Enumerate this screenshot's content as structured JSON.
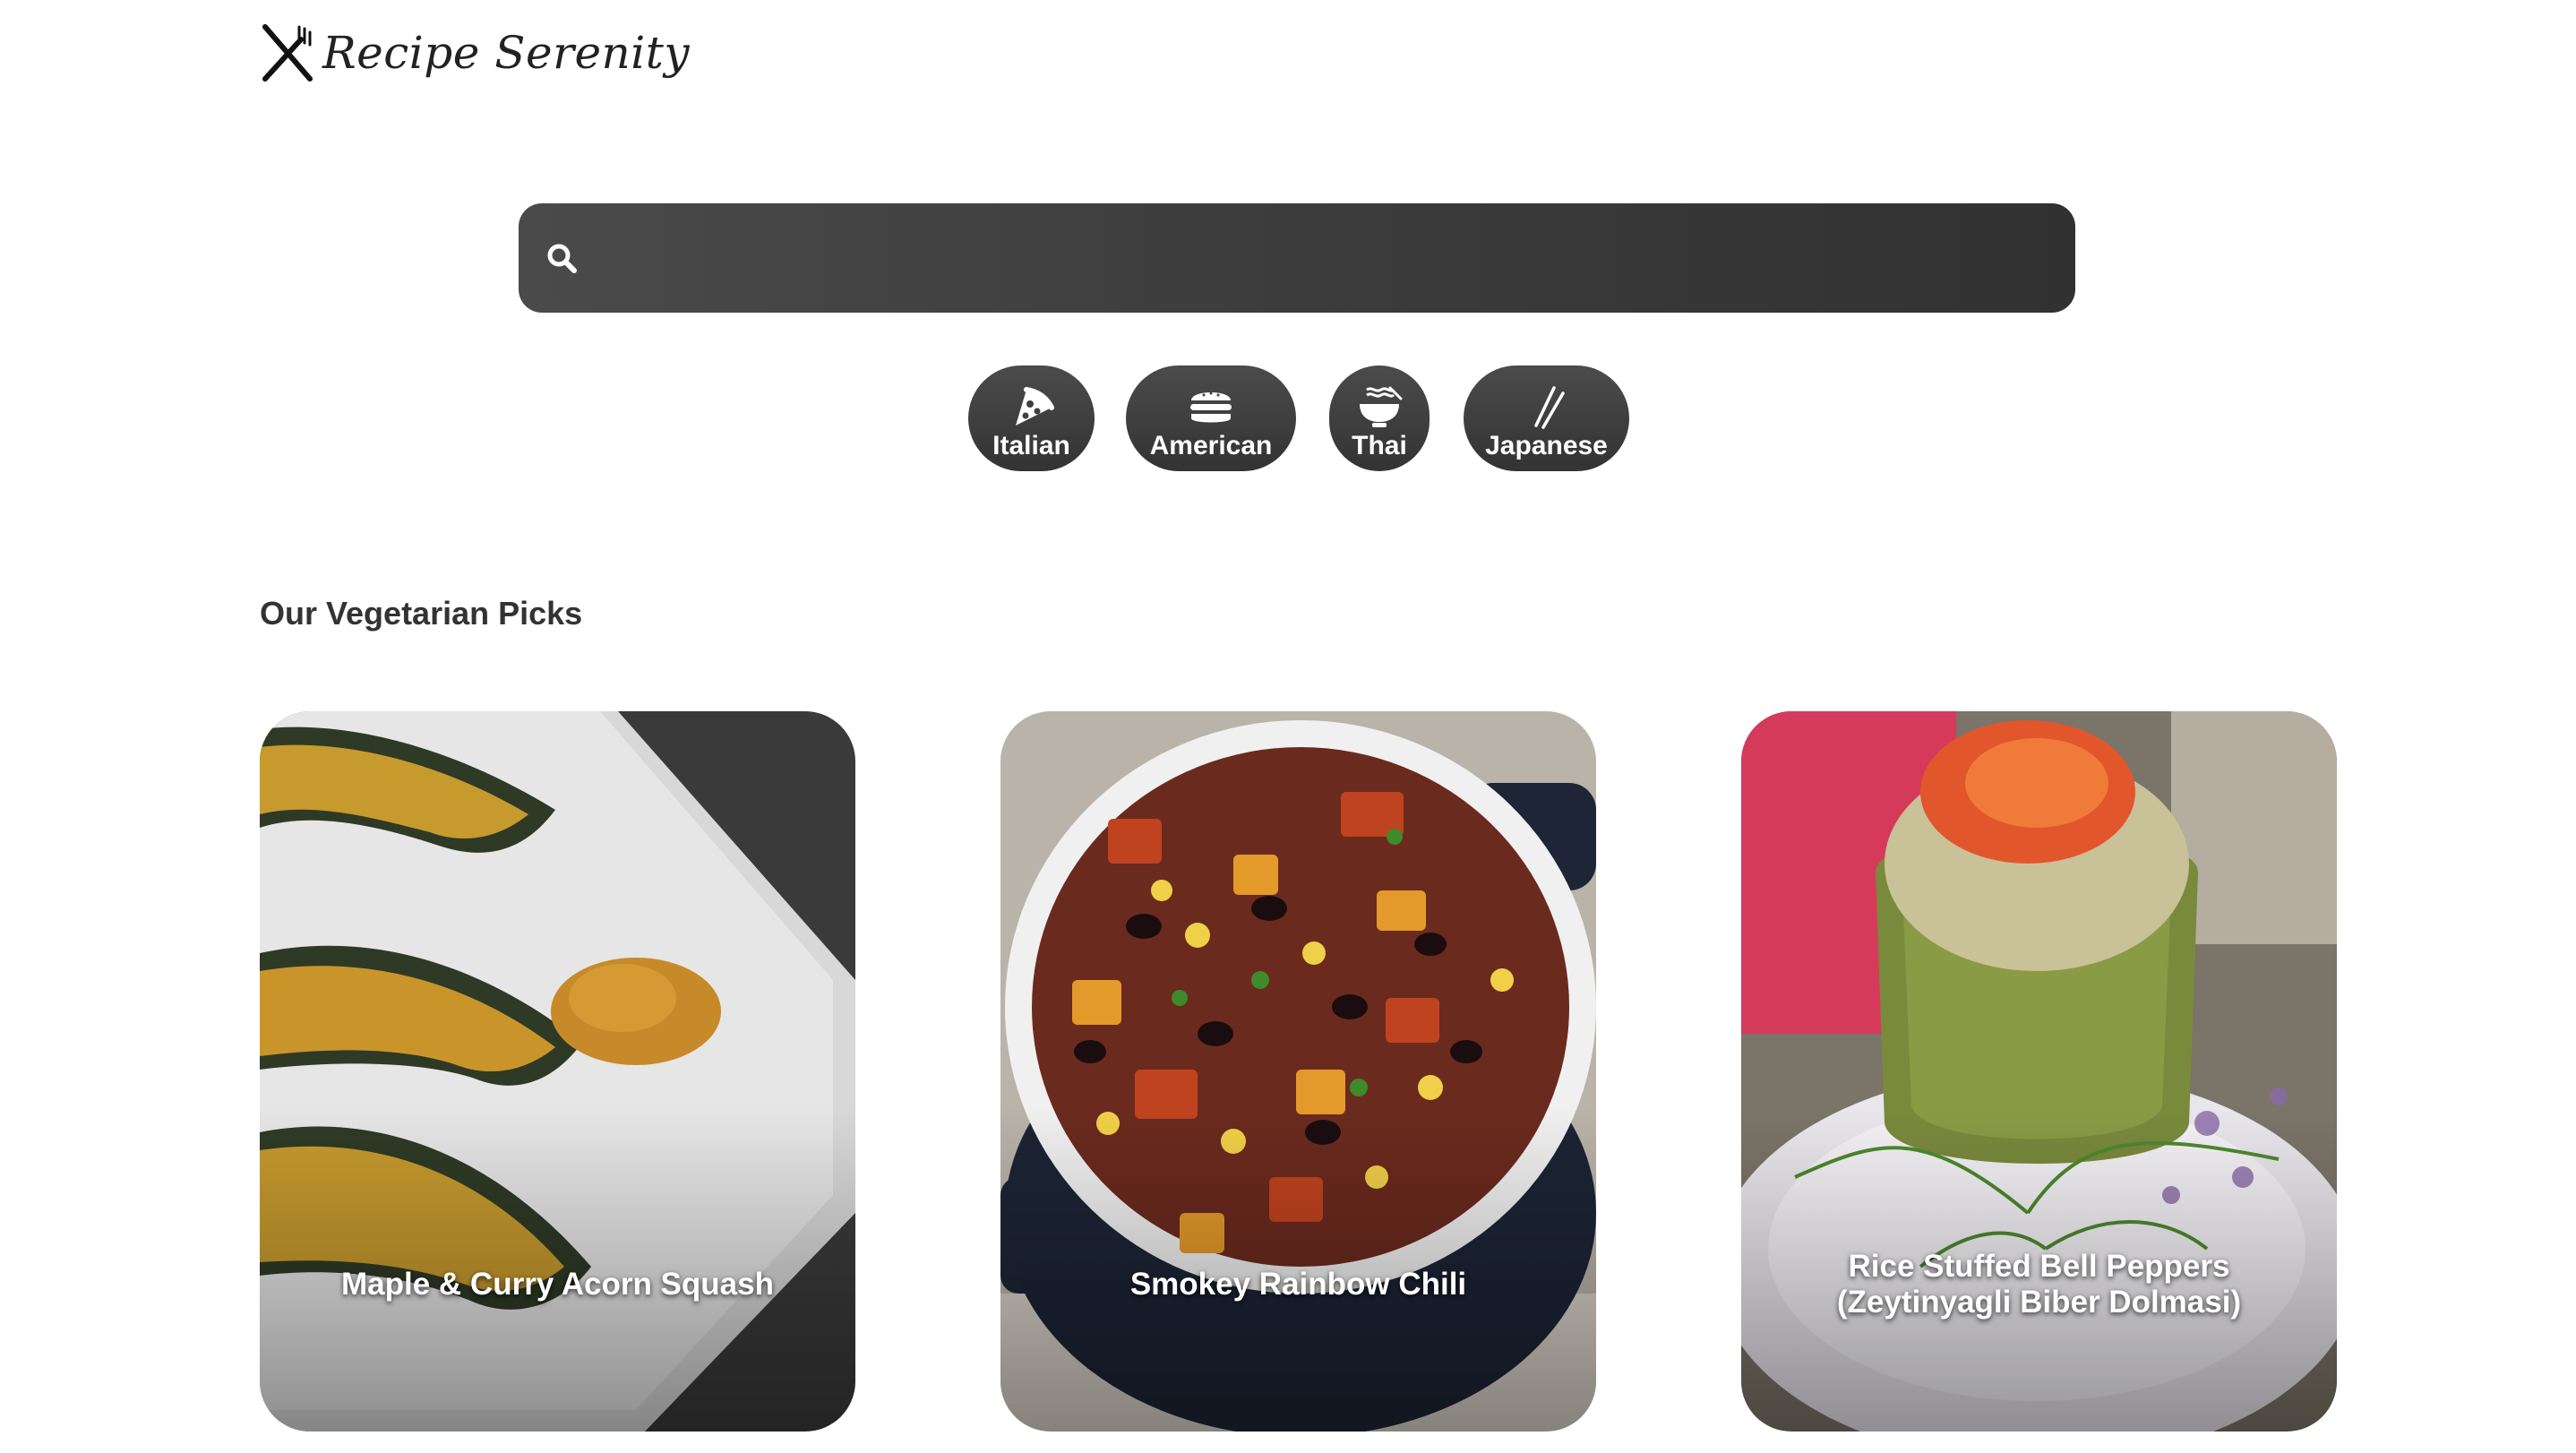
{
  "header": {
    "brand": "Recipe Serenity",
    "logo_icon": "fork-knife-icon"
  },
  "search": {
    "placeholder": "",
    "value": "",
    "icon": "search-icon"
  },
  "cuisines": [
    {
      "label": "Italian",
      "icon": "pizza-icon"
    },
    {
      "label": "American",
      "icon": "burger-icon"
    },
    {
      "label": "Thai",
      "icon": "noodle-bowl-icon"
    },
    {
      "label": "Japanese",
      "icon": "chopsticks-icon"
    }
  ],
  "section": {
    "title": "Our Vegetarian Picks"
  },
  "recipes": [
    {
      "title": "Maple & Curry Acorn Squash"
    },
    {
      "title": "Smokey Rainbow Chili"
    },
    {
      "title": "Rice Stuffed Bell Peppers (Zeytinyagli Biber Dolmasi)"
    }
  ],
  "colors": {
    "search_background": "#3c3c3c",
    "chip_background": "#3f3f3f",
    "text_dark": "#333333"
  }
}
